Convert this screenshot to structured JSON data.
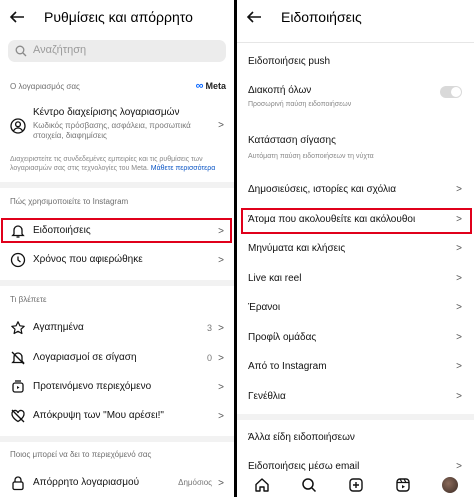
{
  "left": {
    "title": "Ρυθμίσεις και απόρρητο",
    "search_placeholder": "Αναζήτηση",
    "account_section_label": "Ο λογαριασμός σας",
    "meta_logo": "Meta",
    "account_center": {
      "title": "Κέντρο διαχείρισης λογαριασμών",
      "subtitle": "Κωδικός πρόσβασης, ασφάλεια, προσωπικά στοιχεία, διαφημίσεις"
    },
    "note_text": "Διαχειριστείτε τις συνδεδεμένες εμπειρίες και τις ρυθμίσεις των λογαριασμών σας στις τεχνολογίες του Meta.",
    "note_link": "Μάθετε περισσότερα",
    "how_you_use_label": "Πώς χρησιμοποιείτε το Instagram",
    "notifications_label": "Ειδοποιήσεις",
    "time_spent_label": "Χρόνος που αφιερώθηκε",
    "what_you_see_label": "Τι βλέπετε",
    "favorites_label": "Αγαπημένα",
    "favorites_count": "3",
    "muted_label": "Λογαριασμοί σε σίγαση",
    "muted_count": "0",
    "suggested_label": "Προτεινόμενο περιεχόμενο",
    "hide_likes_label": "Απόκρυψη των \"Μου αρέσει!\"",
    "who_can_see_label": "Ποιος μπορεί να δει το περιεχόμενό σας",
    "private_label": "Απόρρητο λογαριασμού",
    "private_value": "Δημόσιος"
  },
  "right": {
    "title": "Ειδοποιήσεις",
    "push_label": "Ειδοποιήσεις push",
    "pause_all_label": "Διακοπή όλων",
    "pause_all_sub": "Προσωρινή παύση ειδοποιήσεων",
    "quiet_mode_label": "Κατάσταση σίγασης",
    "quiet_mode_sub": "Αυτόματη παύση ειδοποιήσεων τη νύχτα",
    "items": [
      "Δημοσιεύσεις, ιστορίες και σχόλια",
      "Άτομα που ακολουθείτε και ακόλουθοι",
      "Μηνύματα και κλήσεις",
      "Live και reel",
      "Έρανοι",
      "Προφίλ ομάδας",
      "Από το Instagram",
      "Γενέθλια"
    ],
    "other_types_label": "Άλλα είδη ειδοποιήσεων",
    "email_label": "Ειδοποιήσεις μέσω email"
  },
  "colors": {
    "highlight": "#e0001b",
    "link": "#0a55c4",
    "meta": "#0866ff"
  }
}
